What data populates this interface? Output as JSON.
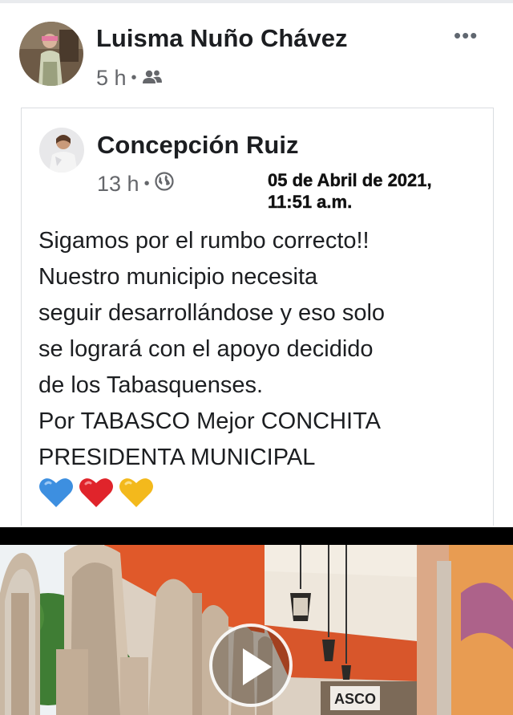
{
  "outer_post": {
    "author": "Luisma Nuño Chávez",
    "time": "5 h",
    "separator": "•",
    "audience_icon": "friends-icon",
    "more_label": "•••"
  },
  "shared_post": {
    "author": "Concepción Ruiz",
    "time": "13 h",
    "separator": "•",
    "audience_icon": "globe-icon",
    "stamp_line1": "05 de Abril de 2021,",
    "stamp_line2": "11:51 a.m.",
    "text_lines": [
      "Sigamos por el rumbo correcto!!",
      "Nuestro municipio necesita",
      "seguir desarrollándose y eso solo",
      "se logrará con el apoyo decidido",
      "de los Tabasquenses.",
      "Por TABASCO Mejor CONCHITA",
      "PRESIDENTA MUNICIPAL"
    ],
    "emoji": [
      "blue-heart-icon",
      "red-heart-icon",
      "yellow-heart-icon"
    ]
  },
  "video": {
    "sign_text": "ASCO",
    "play_icon": "play-icon"
  },
  "colors": {
    "arch_orange": "#e0592a",
    "text": "#1c1e21",
    "meta": "#65676b"
  }
}
